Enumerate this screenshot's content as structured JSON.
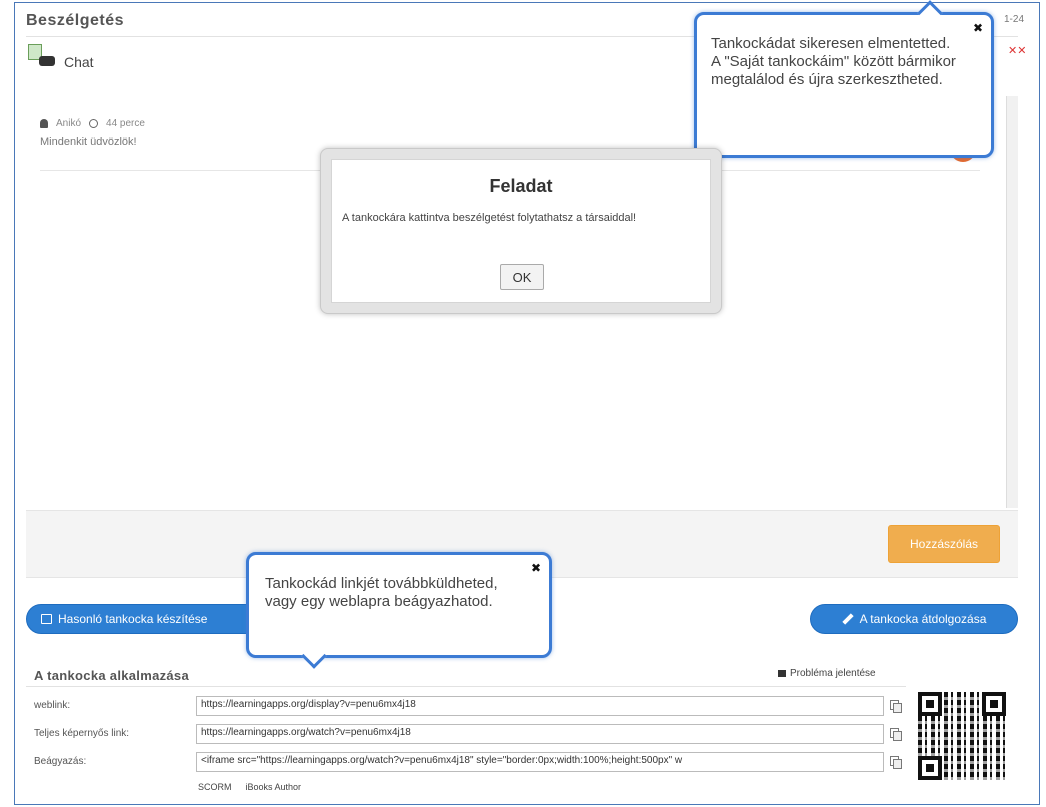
{
  "header": {
    "title": "Beszélgetés",
    "corner_text": "1-24",
    "corner_close": "✕✕"
  },
  "chat": {
    "label": "Chat",
    "message": {
      "author": "Anikó",
      "time": "44 perce",
      "text": "Mindenkit üdvözlök!"
    }
  },
  "modal": {
    "title": "Feladat",
    "body": "A tankockára kattintva beszélgetést folytathatsz a társaiddal!",
    "ok_label": "OK"
  },
  "tooltip_top": {
    "text": "Tankockádat sikeresen elmentetted. A \"Saját tankockáim\" között bármikor megtalálod és újra szerkesztheted.",
    "close": "✖"
  },
  "tooltip_bottom": {
    "text": "Tankockád linkjét továbbküldheted, vagy egy weblapra beágyazhatod.",
    "close": "✖"
  },
  "actions": {
    "submit_label": "Hozzászólás",
    "similar_label": "Hasonló tankocka készítése",
    "edit_label": "A tankocka átdolgozása"
  },
  "usage": {
    "title": "A tankocka alkalmazása",
    "report_label": "Probléma jelentése",
    "rows": [
      {
        "label": "weblink:",
        "value": "https://learningapps.org/display?v=penu6mx4j18"
      },
      {
        "label": "Teljes képernyős link:",
        "value": "https://learningapps.org/watch?v=penu6mx4j18"
      },
      {
        "label": "Beágyazás:",
        "value": "<iframe src=\"https://learningapps.org/watch?v=penu6mx4j18\" style=\"border:0px;width:100%;height:500px\" w"
      }
    ],
    "exports": [
      "SCORM",
      "iBooks Author"
    ]
  },
  "colors": {
    "accent": "#2d7fd3",
    "tooltip_border": "#3c7bd4",
    "submit": "#f0ad4e"
  }
}
